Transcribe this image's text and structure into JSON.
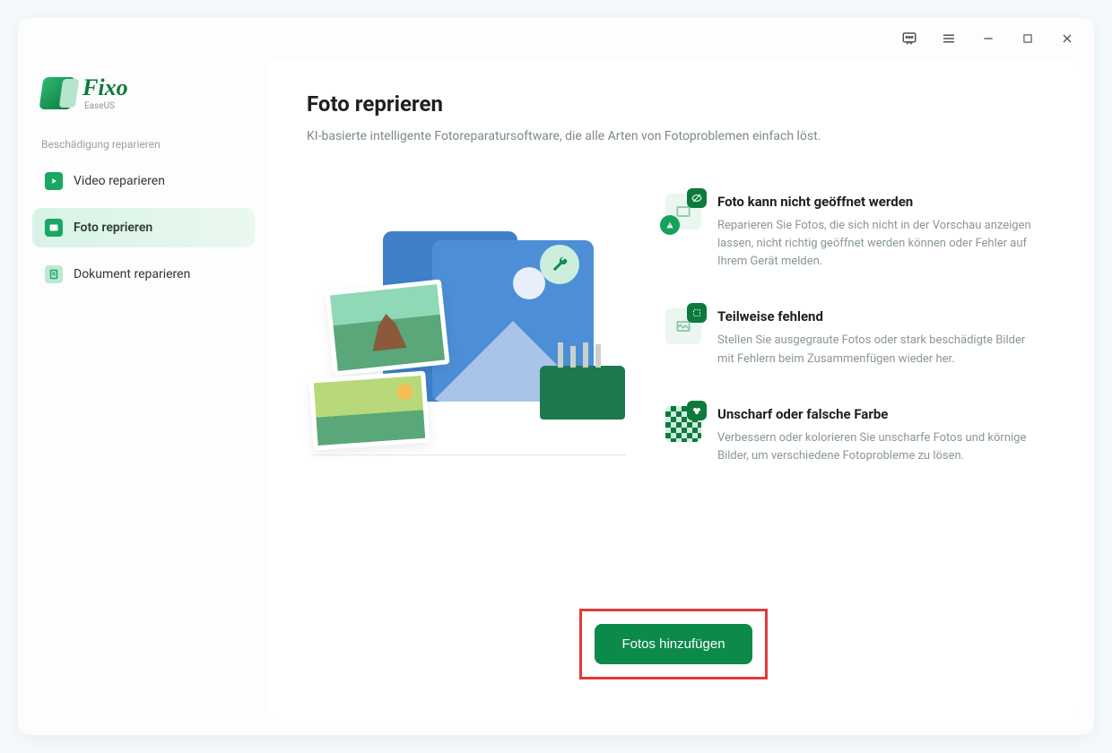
{
  "brand": {
    "title": "Fixo",
    "subtitle": "EaseUS"
  },
  "sidebar": {
    "section_label": "Beschädigung reparieren",
    "items": [
      {
        "label": "Video reparieren"
      },
      {
        "label": "Foto reprieren"
      },
      {
        "label": "Dokument reparieren"
      }
    ]
  },
  "page": {
    "title": "Foto reprieren",
    "subtitle": "KI-basierte intelligente Fotoreparatursoftware, die alle Arten von Fotoproblemen einfach löst."
  },
  "features": [
    {
      "title": "Foto kann nicht geöffnet werden",
      "desc": "Reparieren Sie Fotos, die sich nicht in der Vorschau anzeigen lassen, nicht richtig geöffnet werden können oder Fehler auf Ihrem Gerät melden."
    },
    {
      "title": "Teilweise fehlend",
      "desc": "Stellen Sie ausgegraute Fotos oder stark beschädigte Bilder mit Fehlern beim Zusammenfügen wieder her."
    },
    {
      "title": "Unscharf oder falsche Farbe",
      "desc": "Verbessern oder kolorieren Sie unscharfe Fotos und körnige Bilder, um verschiedene Fotoprobleme zu lösen."
    }
  ],
  "cta": {
    "label": "Fotos hinzufügen"
  }
}
